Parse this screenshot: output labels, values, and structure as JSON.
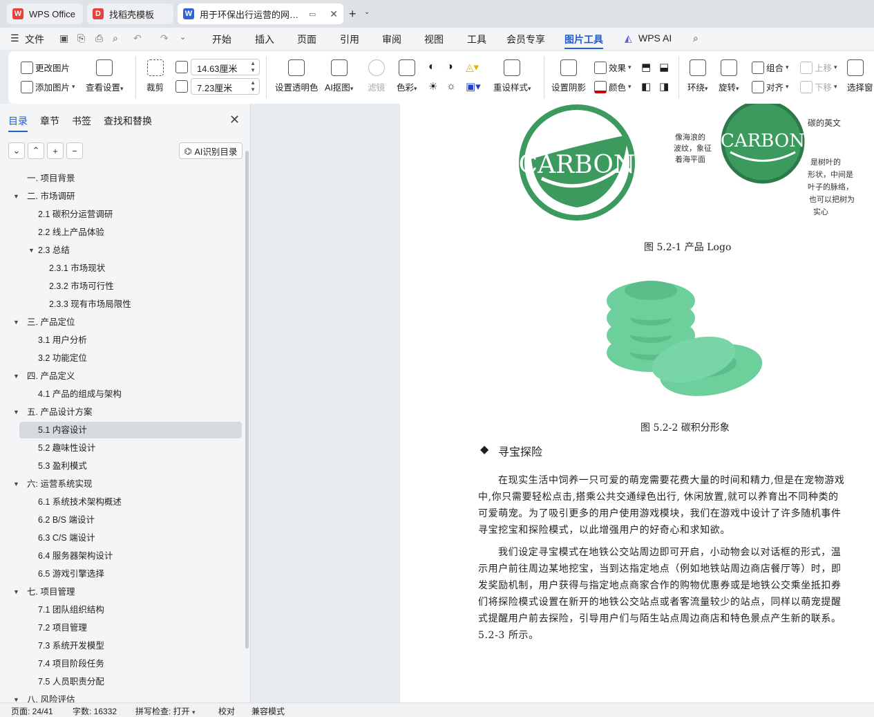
{
  "tabs": [
    {
      "label": "WPS Office",
      "logo": "W",
      "color": "#e8403b"
    },
    {
      "label": "找稻壳模板",
      "logo": "D",
      "color": "#e8403b"
    },
    {
      "label": "用于环保出行运营的网页端系",
      "logo": "W",
      "color": "#2f63d8"
    }
  ],
  "menu": {
    "file": "文件",
    "items": [
      "开始",
      "插入",
      "页面",
      "引用",
      "审阅",
      "视图",
      "工具",
      "会员专享",
      "图片工具",
      "WPS AI"
    ],
    "active": "图片工具"
  },
  "ribbon": {
    "change_picture": "更改图片",
    "add_picture": "添加图片",
    "view_settings": "查看设置",
    "crop": "裁剪",
    "width": "14.63厘米",
    "height": "7.23厘米",
    "set_transparent": "设置透明色",
    "ai_cutout": "AI抠图",
    "filter": "滤镜",
    "color": "色彩",
    "reset_style": "重设样式",
    "set_shadow": "设置阴影",
    "effect": "效果",
    "fill_color": "颜色",
    "wrap": "环绕",
    "rotate": "旋转",
    "group": "组合",
    "align": "对齐",
    "move_up": "上移",
    "move_down": "下移",
    "selection_pane": "选择窗"
  },
  "sidebar": {
    "tabs": [
      "目录",
      "章节",
      "书签",
      "查找和替换"
    ],
    "ai_toc": "AI识别目录",
    "toc": [
      {
        "label": "一. 项目背景",
        "level": 1,
        "toggle": ""
      },
      {
        "label": "二. 市场调研",
        "level": 1,
        "toggle": "▼"
      },
      {
        "label": "2.1  碳积分运营调研",
        "level": 2,
        "toggle": ""
      },
      {
        "label": "2.2  线上产品体验",
        "level": 2,
        "toggle": ""
      },
      {
        "label": "2.3  总结",
        "level": 2,
        "toggle": "▼"
      },
      {
        "label": "2.3.1  市场现状",
        "level": 3,
        "toggle": ""
      },
      {
        "label": "2.3.2  市场可行性",
        "level": 3,
        "toggle": ""
      },
      {
        "label": "2.3.3  现有市场局限性",
        "level": 3,
        "toggle": ""
      },
      {
        "label": "三. 产品定位",
        "level": 1,
        "toggle": "▼"
      },
      {
        "label": "3.1  用户分析",
        "level": 2,
        "toggle": ""
      },
      {
        "label": "3.2  功能定位",
        "level": 2,
        "toggle": ""
      },
      {
        "label": "四. 产品定义",
        "level": 1,
        "toggle": "▼"
      },
      {
        "label": "4.1  产品的组成与架构",
        "level": 2,
        "toggle": ""
      },
      {
        "label": "五. 产品设计方案",
        "level": 1,
        "toggle": "▼"
      },
      {
        "label": "5.1 内容设计",
        "level": 2,
        "toggle": "",
        "selected": true
      },
      {
        "label": "5.2  趣味性设计",
        "level": 2,
        "toggle": ""
      },
      {
        "label": "5.3  盈利模式",
        "level": 2,
        "toggle": ""
      },
      {
        "label": "六: 运营系统实现",
        "level": 1,
        "toggle": "▼"
      },
      {
        "label": "6.1  系统技术架构概述",
        "level": 2,
        "toggle": ""
      },
      {
        "label": "6.2 B/S 端设计",
        "level": 2,
        "toggle": ""
      },
      {
        "label": "6.3 C/S 端设计",
        "level": 2,
        "toggle": ""
      },
      {
        "label": "6.4 服务器架构设计",
        "level": 2,
        "toggle": ""
      },
      {
        "label": "6.5 游戏引擎选择",
        "level": 2,
        "toggle": ""
      },
      {
        "label": "七. 项目管理",
        "level": 1,
        "toggle": "▼"
      },
      {
        "label": "7.1  团队组织结构",
        "level": 2,
        "toggle": ""
      },
      {
        "label": "7.2  项目管理",
        "level": 2,
        "toggle": ""
      },
      {
        "label": "7.3  系统开发模型",
        "level": 2,
        "toggle": ""
      },
      {
        "label": "7.4  项目阶段任务",
        "level": 2,
        "toggle": ""
      },
      {
        "label": "7.5  人员职责分配",
        "level": 2,
        "toggle": ""
      },
      {
        "label": "八. 风险评估",
        "level": 1,
        "toggle": "▼"
      }
    ]
  },
  "document": {
    "logo_text": "CARBON",
    "sketch_notes": {
      "left": "像海浪的\n波纹，象征\n着海平面",
      "right_top": "碳的英文",
      "right": "是树叶的\n形状，中间是\n叶子的脉络，\n也可以把树为\n实心"
    },
    "caption1": "图 5.2-1 产品 Logo",
    "caption2": "图 5.2-2 碳积分形象",
    "heading": "寻宝探险",
    "para1": [
      "在现实生活中饲养一只可爱的萌宠需要花费大量的时间和精力,但是在宠物游戏",
      "中,你只需要轻松点击,搭乘公共交通绿色出行, 休闲放置,就可以养育出不同种类的",
      "可爱萌宠。为了吸引更多的用户使用游戏模块，我们在游戏中设计了许多随机事件",
      "寻宝挖宝和探险模式，以此增强用户的好奇心和求知欲。"
    ],
    "para2": [
      "我们设定寻宝模式在地铁公交站周边即可开启，小动物会以对话框的形式，温",
      "示用户前往周边某地挖宝，当到达指定地点（例如地铁站周边商店餐厅等）时，即",
      "发奖励机制，用户获得与指定地点商家合作的购物优惠券或是地铁公交乘坐抵扣券",
      "们将探险模式设置在新开的地铁公交站点或者客流量较少的站点，同样以萌宠提醒",
      "式提醒用户前去探险，引导用户们与陌生站点周边商店和特色景点产生新的联系。",
      "5.2-3 所示。"
    ]
  },
  "status": {
    "page": "页面: 24/41",
    "words": "字数: 16332",
    "spell": "拼写检查: 打开",
    "proof": "校对",
    "compat": "兼容模式"
  },
  "colors": {
    "accent": "#1f5cd6",
    "logo_green": "#3c9a5f",
    "coin_green": "#6dcf9c"
  }
}
